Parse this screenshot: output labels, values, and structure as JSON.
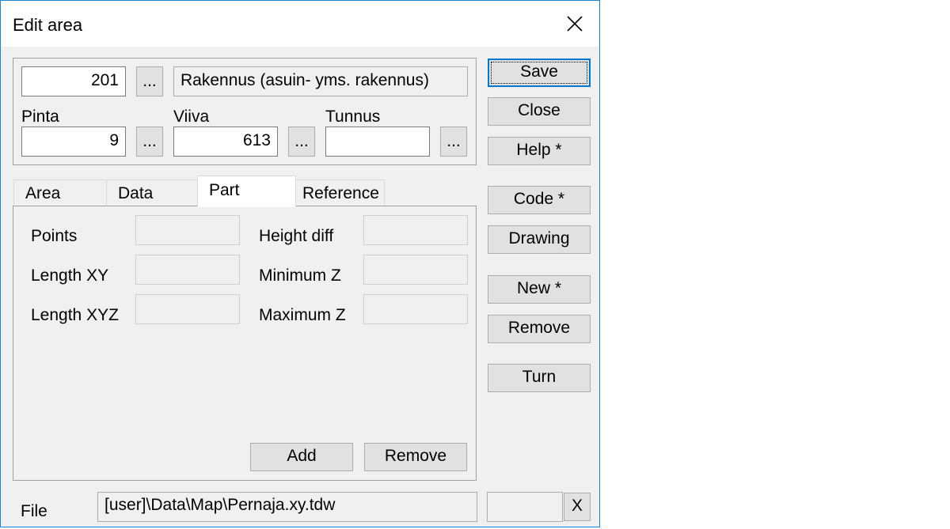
{
  "window": {
    "title": "Edit area"
  },
  "header": {
    "code_value": "201",
    "code_description": "Rakennus (asuin- yms. rakennus)",
    "browse_label": "...",
    "pinta_label": "Pinta",
    "pinta_value": "9",
    "viiva_label": "Viiva",
    "viiva_value": "613",
    "tunnus_label": "Tunnus",
    "tunnus_value": ""
  },
  "tabs": [
    {
      "label": "Area"
    },
    {
      "label": "Data"
    },
    {
      "label": "Part"
    },
    {
      "label": "Reference"
    }
  ],
  "active_tab": "Part",
  "part": {
    "points_label": "Points",
    "points_value": "",
    "length_xy_label": "Length XY",
    "length_xy_value": "",
    "length_xyz_label": "Length XYZ",
    "length_xyz_value": "",
    "height_diff_label": "Height diff",
    "height_diff_value": "",
    "minimum_z_label": "Minimum Z",
    "minimum_z_value": "",
    "maximum_z_label": "Maximum Z",
    "maximum_z_value": "",
    "add_label": "Add",
    "remove_label": "Remove"
  },
  "side_buttons": {
    "save": "Save",
    "close": "Close",
    "help": "Help *",
    "code": "Code *",
    "drawing": "Drawing",
    "new": "New *",
    "remove": "Remove",
    "turn": "Turn"
  },
  "file": {
    "label": "File",
    "path": "[user]\\Data\\Map\\Pernaja.xy.tdw",
    "extra_value": "",
    "clear_label": "X"
  },
  "colors": {
    "accent": "#0078d7",
    "window_border": "#1883d7",
    "dialog_bg": "#f0f0f0",
    "button_bg": "#e1e1e1"
  }
}
